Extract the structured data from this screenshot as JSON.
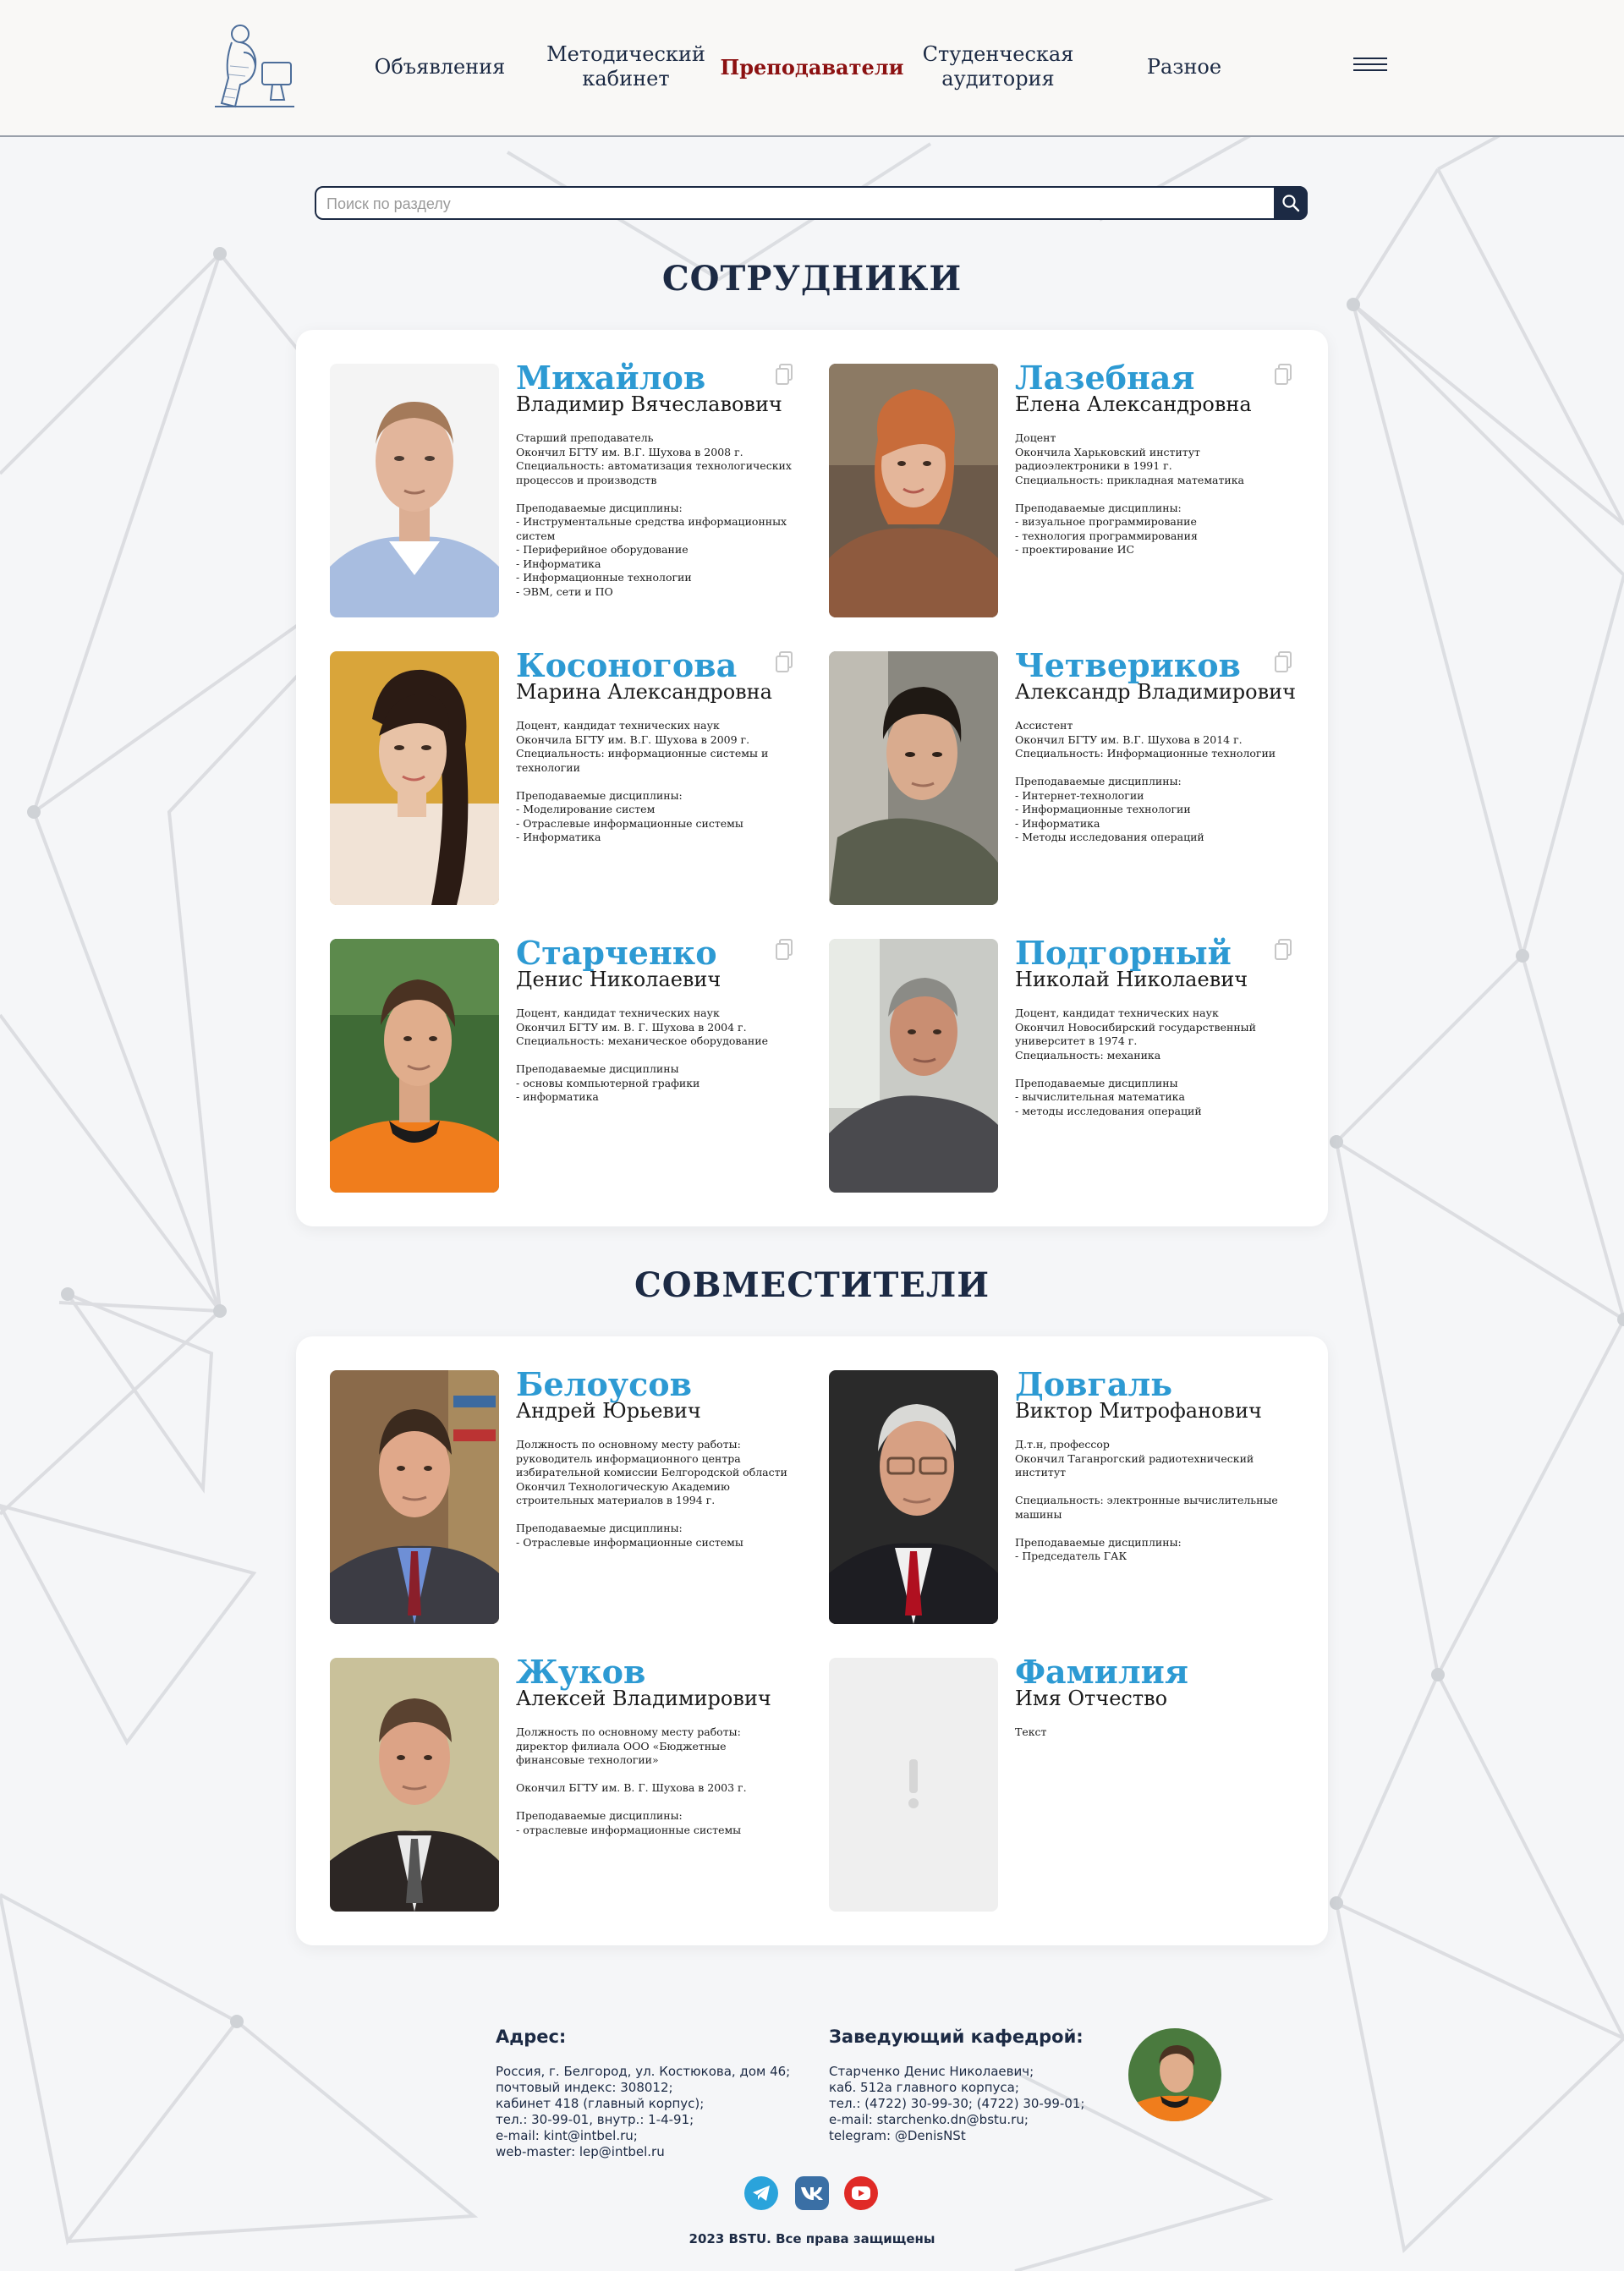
{
  "nav": {
    "items": [
      "Объявления",
      "Методический\nкабинет",
      "Преподаватели",
      "Студенческая\nаудитория",
      "Разное"
    ],
    "active": "Преподаватели"
  },
  "search": {
    "placeholder": "Поиск по разделу"
  },
  "sections": {
    "staff_title": "СОТРУДНИКИ",
    "parttime_title": "СОВМЕСТИТЕЛИ"
  },
  "staff": [
    {
      "surname": "Михайлов",
      "given": "Владимир Вячеславович",
      "desc": "Старший преподаватель\nОкончил БГТУ им. В.Г. Шухова в 2008 г.\nСпециальность: автоматизация технологических процессов и производств\n\nПреподаваемые дисциплины:\n- Инструментальные средства информационных систем\n- Периферийное оборудование\n- Информатика\n- Информационные технологии\n- ЭВМ, сети и ПО"
    },
    {
      "surname": "Лазебная",
      "given": "Елена Александровна",
      "desc": "Доцент\nОкончила Харьковский институт радиоэлектроники в 1991 г.\nСпециальность: прикладная математика\n\nПреподаваемые дисциплины:\n- визуальное программирование\n- технология программирования\n- проектирование ИС"
    },
    {
      "surname": "Косоногова",
      "given": "Марина Александровна",
      "desc": "Доцент, кандидат технических наук\nОкончила БГТУ им. В.Г. Шухова в 2009 г.\nСпециальность: информационные системы и технологии\n\nПреподаваемые дисциплины:\n- Моделирование систем\n- Отраслевые информационные системы\n- Информатика"
    },
    {
      "surname": "Четвериков",
      "given": "Александр Владимирович",
      "desc": "Ассистент\nОкончил БГТУ им. В.Г. Шухова в 2014 г.\nСпециальность: Информационные технологии\n\nПреподаваемые дисциплины:\n- Интернет-технологии\n- Информационные технологии\n- Информатика\n- Методы исследования операций"
    },
    {
      "surname": "Старченко",
      "given": "Денис Николаевич",
      "desc": "Доцент, кандидат технических наук\nОкончил БГТУ им. В. Г. Шухова в 2004 г.\nСпециальность: механическое оборудование\n\nПреподаваемые дисциплины\n- основы компьютерной графики\n- информатика"
    },
    {
      "surname": "Подгорный",
      "given": "Николай Николаевич",
      "desc": "Доцент, кандидат технических наук\nОкончил Новосибирский государственный университет в 1974 г.\nСпециальность: механика\n\nПреподаваемые дисциплины\n- вычислительная математика\n- методы исследования операций"
    }
  ],
  "parttime": [
    {
      "surname": "Белоусов",
      "given": "Андрей Юрьевич",
      "desc": "Должность по основному месту работы: руководитель информационного центра избирательной комиссии Белгородской области\nОкончил Технологическую Академию строительных материалов в 1994 г.\n\nПреподаваемые дисциплины:\n- Отраслевые информационные системы"
    },
    {
      "surname": "Довгаль",
      "given": "Виктор Митрофанович",
      "desc": "Д.т.н, профессор\nОкончил Таганрогский радиотехнический институт\n\nСпециальность: электронные вычислительные машины\n\nПреподаваемые дисциплины:\n- Председатель ГАК"
    },
    {
      "surname": "Жуков",
      "given": "Алексей Владимирович",
      "desc": "Должность по основному месту работы: директор филиала ООО «Бюджетные финансовые технологии»\n\nОкончил БГТУ им. В. Г. Шухова в 2003 г.\n\nПреподаваемые дисциплины:\n- отраслевые информационные системы"
    },
    {
      "surname": "Фамилия",
      "given": "Имя Отчество",
      "desc": "Текст"
    }
  ],
  "footer": {
    "address_title": "Адрес:",
    "address_text": "Россия, г. Белгород, ул. Костюкова, дом 46;\nпочтовый индекс: 308012;\nкабинет 418 (главный корпус);\nтел.: 30-99-01, внутр.: 1-4-91;\ne-mail: kint@intbel.ru;\nweb-master: lep@intbel.ru",
    "head_title": "Заведующий кафедрой:",
    "head_text": "Старченко Денис Николаевич;\nкаб. 512а главного корпуса;\nтел.: (4722) 30-99-30; (4722) 30-99-01;\ne-mail: starchenko.dn@bstu.ru;\ntelegram: @DenisNSt",
    "copyright": "2023 BSTU. Все права защищены"
  },
  "colors": {
    "navy": "#1c2a44",
    "accent_blue": "#2d9ad3",
    "active_red": "#8c1111",
    "telegram": "#2aa3db",
    "vk": "#3a6fa5",
    "youtube": "#e02a26"
  },
  "icons": [
    "logo-thinker-icon",
    "burger-menu-icon",
    "search-icon",
    "copy-icon",
    "telegram-icon",
    "vk-icon",
    "youtube-icon"
  ]
}
